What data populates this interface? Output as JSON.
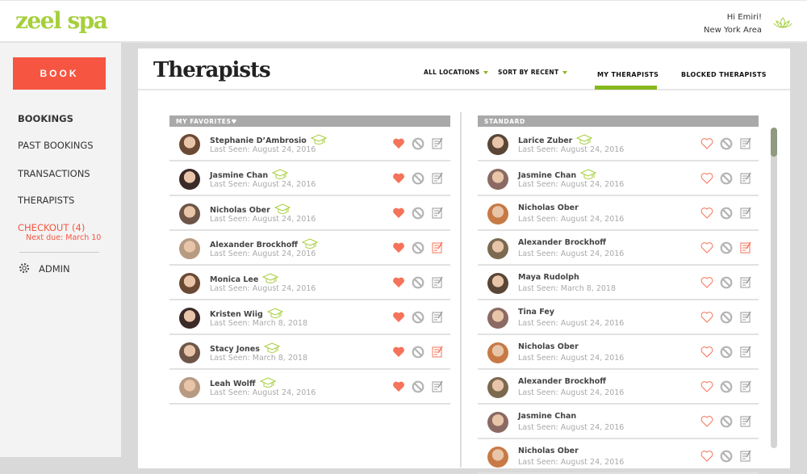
{
  "header": {
    "logo": "zeel spa",
    "greeting": "Hi Emiri!",
    "location": "New York Area"
  },
  "sidebar": {
    "book_label": "BOOK",
    "items": [
      {
        "label": "BOOKINGS",
        "active": true
      },
      {
        "label": "PAST BOOKINGS"
      },
      {
        "label": "TRANSACTIONS"
      },
      {
        "label": "THERAPISTS"
      }
    ],
    "checkout": {
      "label": "CHECKOUT (4)",
      "sub": "Next due: March 10"
    },
    "admin_label": "ADMIN"
  },
  "main": {
    "title": "Therapists",
    "filters": {
      "location": "ALL LOCATIONS",
      "sort": "SORT BY RECENT"
    },
    "tabs": [
      {
        "label": "MY THERAPISTS",
        "active": true
      },
      {
        "label": "BLOCKED THERAPISTS"
      }
    ],
    "favorites": {
      "header": "MY FAVORITES♥",
      "rows": [
        {
          "name": "Stephanie D’Ambrosio",
          "last_seen": "Last Seen: August 24, 2016",
          "cap": true,
          "favorite": true,
          "note": false,
          "avatar": "#6b4a35"
        },
        {
          "name": "Jasmine Chan",
          "last_seen": "Last Seen: August 24, 2016",
          "cap": true,
          "favorite": true,
          "note": false,
          "avatar": "#3a2a28"
        },
        {
          "name": "Nicholas Ober",
          "last_seen": "Last Seen: August 24, 2016",
          "cap": true,
          "favorite": true,
          "note": false,
          "avatar": "#6d5548"
        },
        {
          "name": "Alexander Brockhoff",
          "last_seen": "Last Seen: August 24, 2016",
          "cap": true,
          "favorite": true,
          "note": true,
          "avatar": "#b69a82"
        },
        {
          "name": "Monica Lee",
          "last_seen": "Last Seen: August 24, 2016",
          "cap": true,
          "favorite": true,
          "note": false,
          "avatar": "#6b4a35"
        },
        {
          "name": "Kristen Wiig",
          "last_seen": "Last Seen: March 8, 2018",
          "cap": true,
          "favorite": true,
          "note": false,
          "avatar": "#3a2a28"
        },
        {
          "name": "Stacy Jones",
          "last_seen": "Last Seen: March 8, 2018",
          "cap": true,
          "favorite": true,
          "note": true,
          "avatar": "#6d5548"
        },
        {
          "name": "Leah Wolff",
          "last_seen": "Last Seen: August 24, 2016",
          "cap": true,
          "favorite": true,
          "note": false,
          "avatar": "#b69a82"
        }
      ]
    },
    "standard": {
      "header": "STANDARD",
      "rows": [
        {
          "name": "Larice Zuber",
          "last_seen": "Last Seen: August 24, 2016",
          "cap": true,
          "favorite": false,
          "note": false,
          "avatar": "#5a4636"
        },
        {
          "name": "Jasmine Chan",
          "last_seen": "Last Seen: August 24, 2016",
          "cap": true,
          "favorite": false,
          "note": false,
          "avatar": "#8a6a62"
        },
        {
          "name": "Nicholas Ober",
          "last_seen": "Last Seen: August 24, 2016",
          "cap": false,
          "favorite": false,
          "note": false,
          "avatar": "#c77a45"
        },
        {
          "name": "Alexander Brockhoff",
          "last_seen": "Last Seen: August 24, 2016",
          "cap": false,
          "favorite": false,
          "note": true,
          "avatar": "#7b6a50"
        },
        {
          "name": "Maya Rudolph",
          "last_seen": "Last Seen: March 8, 2018",
          "cap": false,
          "favorite": false,
          "note": false,
          "avatar": "#5a4636"
        },
        {
          "name": "Tina Fey",
          "last_seen": "Last Seen: August 24, 2016",
          "cap": false,
          "favorite": false,
          "note": false,
          "avatar": "#8a6a62"
        },
        {
          "name": "Nicholas Ober",
          "last_seen": "Last Seen: August 24, 2016",
          "cap": false,
          "favorite": false,
          "note": false,
          "avatar": "#c77a45"
        },
        {
          "name": "Alexander Brockhoff",
          "last_seen": "Last Seen: August 24, 2016",
          "cap": false,
          "favorite": false,
          "note": false,
          "avatar": "#7b6a50"
        },
        {
          "name": "Jasmine Chan",
          "last_seen": "Last Seen: August 24, 2016",
          "cap": false,
          "favorite": false,
          "note": false,
          "avatar": "#8a6a62"
        },
        {
          "name": "Nicholas Ober",
          "last_seen": "Last Seen: August 24, 2016",
          "cap": false,
          "favorite": false,
          "note": false,
          "avatar": "#c77a45"
        }
      ]
    }
  },
  "colors": {
    "accent": "#86b81d",
    "logo": "#a6cf3c",
    "book": "#f65541",
    "heart": "#f5735a",
    "checkout": "#f65541"
  }
}
